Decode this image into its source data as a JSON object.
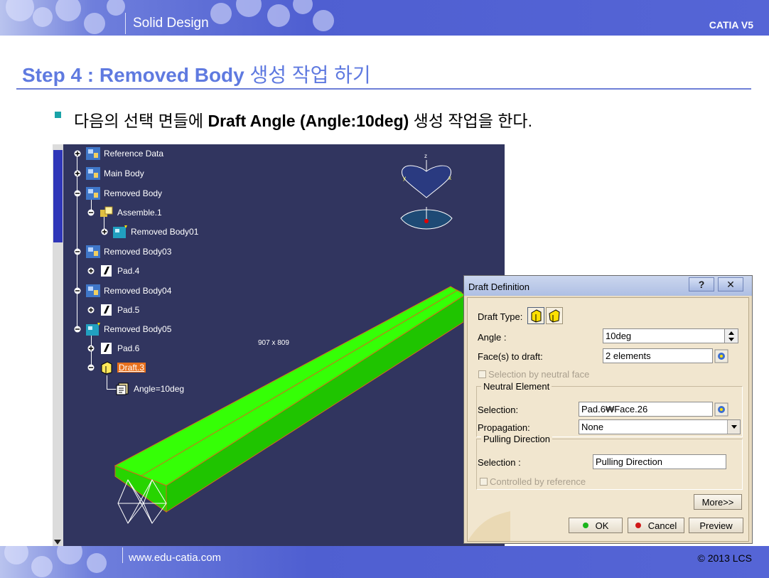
{
  "header": {
    "title": "Solid Design",
    "brand": "CATIA V5"
  },
  "footer": {
    "url": "www.edu-catia.com",
    "copyright": "© 2013 LCS"
  },
  "step": {
    "prefix": "Step 4 : Removed Body",
    "suffix": "생성 작업 하기"
  },
  "bullet": {
    "pre": "다음의 선택 면들에",
    "bold": "Draft Angle (Angle:10deg)",
    "post": "생성 작업을 한다."
  },
  "tree": {
    "items": [
      {
        "label": "Reference Data",
        "icon": "body-icon"
      },
      {
        "label": "Main Body",
        "icon": "body-icon"
      },
      {
        "label": "Removed Body",
        "icon": "body-icon"
      },
      {
        "label": "Assemble.1",
        "icon": "assemble-icon"
      },
      {
        "label": "Removed Body01",
        "icon": "body-active-icon"
      },
      {
        "label": "Removed Body03",
        "icon": "body-icon"
      },
      {
        "label": "Pad.4",
        "icon": "pad-icon"
      },
      {
        "label": "Removed Body04",
        "icon": "body-icon"
      },
      {
        "label": "Pad.5",
        "icon": "pad-icon"
      },
      {
        "label": "Removed Body05",
        "icon": "body-active-icon"
      },
      {
        "label": "Pad.6",
        "icon": "pad-icon"
      },
      {
        "label": "Draft.3",
        "icon": "draft-icon",
        "selected": true
      },
      {
        "label": "Angle=10deg",
        "icon": "parameter-icon"
      }
    ]
  },
  "viewport": {
    "coord_x": "907",
    "coord_sep": "x",
    "coord_y": "809",
    "compass_z": "z",
    "compass_x": "x",
    "compass_y": "y"
  },
  "dialog": {
    "title": "Draft Definition",
    "help_label": "?",
    "close_label": "✕",
    "draft_type_label": "Draft Type:",
    "angle_label": "Angle :",
    "angle_value": "10deg",
    "faces_label": "Face(s) to draft:",
    "faces_value": "2 elements",
    "neutral_face_label": "Selection by neutral face",
    "neutral_group": "Neutral Element",
    "neutral_selection_label": "Selection:",
    "neutral_selection_value": "Pad.6₩Face.26",
    "propagation_label": "Propagation:",
    "propagation_value": "None",
    "pulling_group": "Pulling Direction",
    "pulling_selection_label": "Selection :",
    "pulling_selection_value": "Pulling Direction",
    "controlled_label": "Controlled by reference",
    "more_label": "More>>",
    "ok_label": "OK",
    "cancel_label": "Cancel",
    "preview_label": "Preview"
  },
  "colors": {
    "accent_title": "#5f7ae0",
    "viewport_bg": "#31355f",
    "part_green": "#33ff00",
    "selected_node": "#e8701c"
  }
}
